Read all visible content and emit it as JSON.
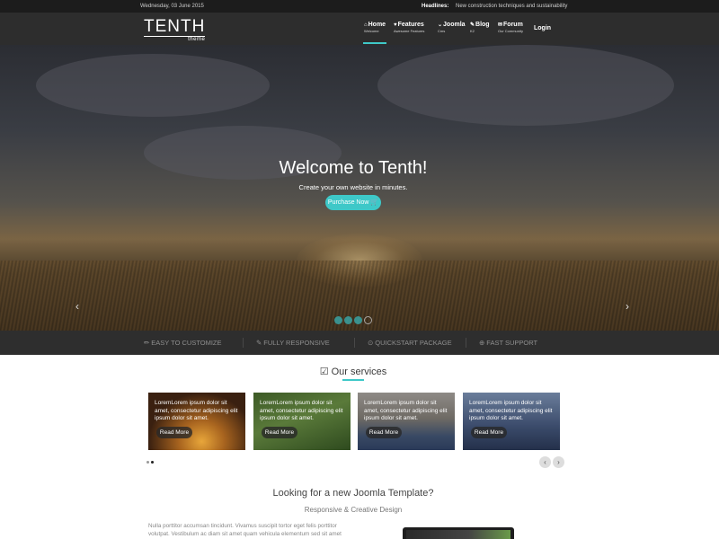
{
  "topbar": {
    "date": "Wednesday, 03 June 2015",
    "headlines_label": "Headlines:",
    "headlines_text": "New construction techniques and sustainability"
  },
  "logo": {
    "main": "TENTH",
    "sub": "theme"
  },
  "nav": [
    {
      "label": "Home",
      "sub": "Welcome",
      "icon": "home-icon",
      "glyph": "⌂"
    },
    {
      "label": "Features",
      "sub": "Awesome Features",
      "icon": "heart-icon",
      "glyph": "♥"
    },
    {
      "label": "Joomla",
      "sub": "Cms",
      "icon": "chevron-down-icon",
      "glyph": "⌄"
    },
    {
      "label": "Blog",
      "sub": "K2",
      "icon": "edit-icon",
      "glyph": "✎"
    },
    {
      "label": "Forum",
      "sub": "Our Community",
      "icon": "comments-icon",
      "glyph": "✉"
    },
    {
      "label": "Login",
      "sub": ""
    }
  ],
  "hero": {
    "title": "Welcome to Tenth!",
    "subtitle": "Create your own website in minutes.",
    "button": "Purchase Now 🛒",
    "prev": "‹",
    "next": "›"
  },
  "features": [
    {
      "label": "EASY TO CUSTOMIZE",
      "icon": "magic-icon",
      "glyph": "✏"
    },
    {
      "label": "FULLY RESPONSIVE",
      "icon": "wrench-icon",
      "glyph": "✎"
    },
    {
      "label": "QUICKSTART PACKAGE",
      "icon": "clock-icon",
      "glyph": "⊙"
    },
    {
      "label": "FAST SUPPORT",
      "icon": "lifebuoy-icon",
      "glyph": "⊕"
    }
  ],
  "services": {
    "title": "Our services",
    "icon": "check-square-icon",
    "glyph": "☑",
    "cards": [
      {
        "text": "LoremLorem ipsum dolor sit amet, consectetur adipiscing elit ipsum dolor sit amet.",
        "button": "Read More"
      },
      {
        "text": "LoremLorem ipsum dolor sit amet, consectetur adipiscing elit ipsum dolor sit amet.",
        "button": "Read More"
      },
      {
        "text": "LoremLorem ipsum dolor sit amet, consectetur adipiscing elit ipsum dolor sit amet.",
        "button": "Read More"
      },
      {
        "text": "LoremLorem ipsum dolor sit amet, consectetur adipiscing elit ipsum dolor sit amet.",
        "button": "Read More"
      }
    ],
    "prev": "‹",
    "next": "›"
  },
  "promo": {
    "title": "Looking for a new Joomla Template?",
    "subtitle": "Responsive & Creative Design",
    "text": "Nulla porttitor accumsan tincidunt. Vivamus suscipit tortor eget felis porttitor volutpat. Vestibulum ac diam sit amet quam vehicula elementum sed sit amet"
  },
  "colors": {
    "accent": "#3ec8c8",
    "header": "#2d2d2d",
    "topbar": "#1c1c1c",
    "features_bar": "#2e2e2e"
  }
}
